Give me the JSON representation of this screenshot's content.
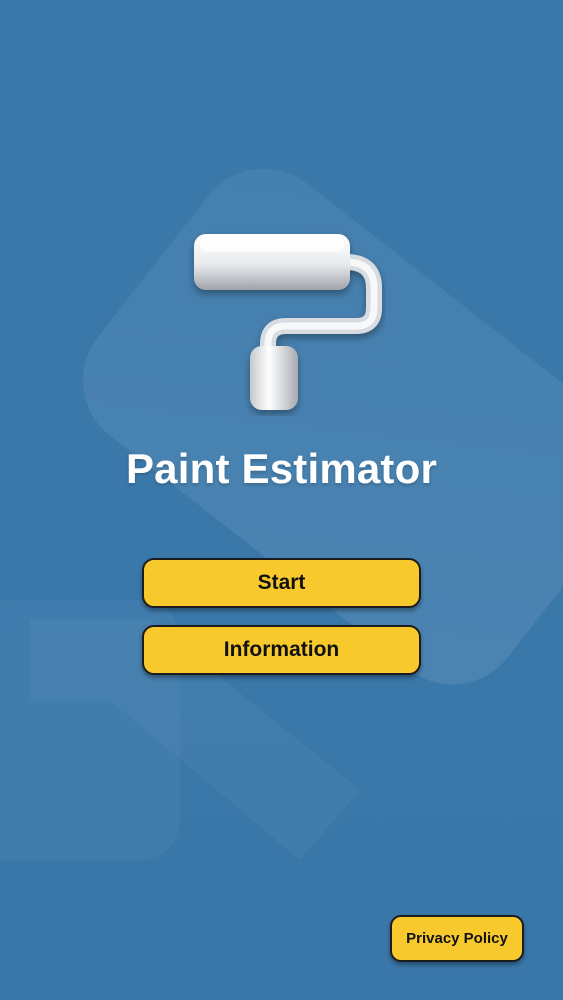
{
  "app": {
    "title": "Paint Estimator",
    "logo_icon": "paint-roller-icon"
  },
  "menu": {
    "start_label": "Start",
    "information_label": "Information"
  },
  "footer": {
    "privacy_label": "Privacy Policy"
  },
  "colors": {
    "background": "#3a78aa",
    "button": "#f8c92c",
    "button_border": "#1c1c1c",
    "title_text": "#ffffff"
  }
}
